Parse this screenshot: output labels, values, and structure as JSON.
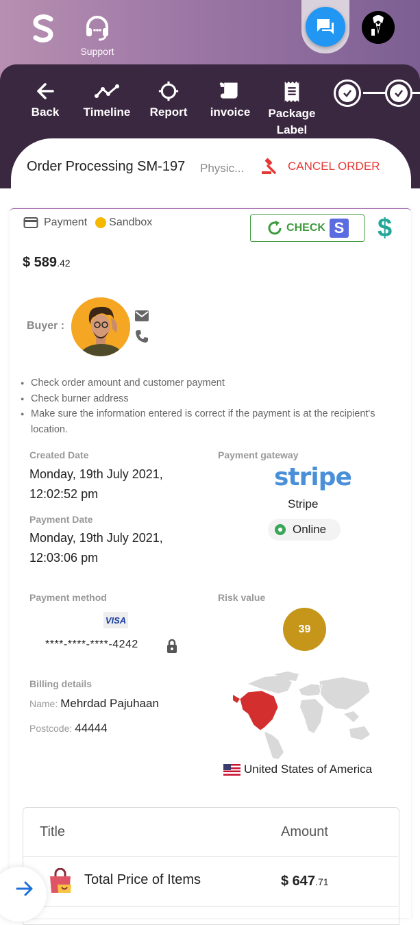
{
  "topbar": {
    "support_label": "Support",
    "icons": [
      "brand-logo-icon",
      "headset-icon",
      "chat-icon",
      "user-avatar"
    ]
  },
  "nav": {
    "items": [
      {
        "label": "Back",
        "icon": "arrow-left-icon"
      },
      {
        "label": "Timeline",
        "icon": "timeline-icon"
      },
      {
        "label": "Report",
        "icon": "crosshair-icon"
      },
      {
        "label": "invoice",
        "icon": "scroll-icon"
      },
      {
        "label": "Package Label",
        "icon": "receipt-icon"
      }
    ],
    "steps_completed": 2
  },
  "order": {
    "title": "Order Processing SM-197",
    "type": "Physic...",
    "cancel_label": "CANCEL ORDER"
  },
  "payment": {
    "label": "Payment",
    "mode": "Sandbox",
    "check_label": "CHECK",
    "check_badge": "S",
    "amount_main": "$ 589",
    "amount_cents": ".42"
  },
  "buyer": {
    "label": "Buyer :"
  },
  "notes": [
    "Check order amount and customer payment",
    "Check burner address",
    "Make sure the information entered is correct if the payment is at the recipient's location."
  ],
  "details": {
    "created_label": "Created Date",
    "created_value_1": "Monday, 19th July 2021,",
    "created_value_2": "12:02:52 pm",
    "payment_date_label": "Payment Date",
    "payment_date_value_1": "Monday, 19th July 2021,",
    "payment_date_value_2": "12:03:06 pm",
    "gateway_label": "Payment gateway",
    "gateway_logo": "stripe",
    "gateway_name": "Stripe",
    "gateway_status": "Online",
    "method_label": "Payment method",
    "card_brand": "VISA",
    "card_number": "****-****-****-4242",
    "risk_label": "Risk value",
    "risk_value": "39"
  },
  "billing": {
    "label": "Billing details",
    "name_label": "Name:",
    "name_value": "Mehrdad Pajuhaan",
    "postcode_label": "Postcode:",
    "postcode_value": "44444",
    "country": "United States of America"
  },
  "table": {
    "col_title": "Title",
    "col_amount": "Amount",
    "rows": [
      {
        "label": "Total Price of Items",
        "amount_main": "$ 647",
        "amount_cents": ".71"
      }
    ]
  },
  "colors": {
    "nav_bg": "#3a2740",
    "cancel": "#e53935",
    "check": "#3c9a3c",
    "stripe": "#4a90d9",
    "risk": "#c6961a",
    "chat": "#2196f3"
  }
}
